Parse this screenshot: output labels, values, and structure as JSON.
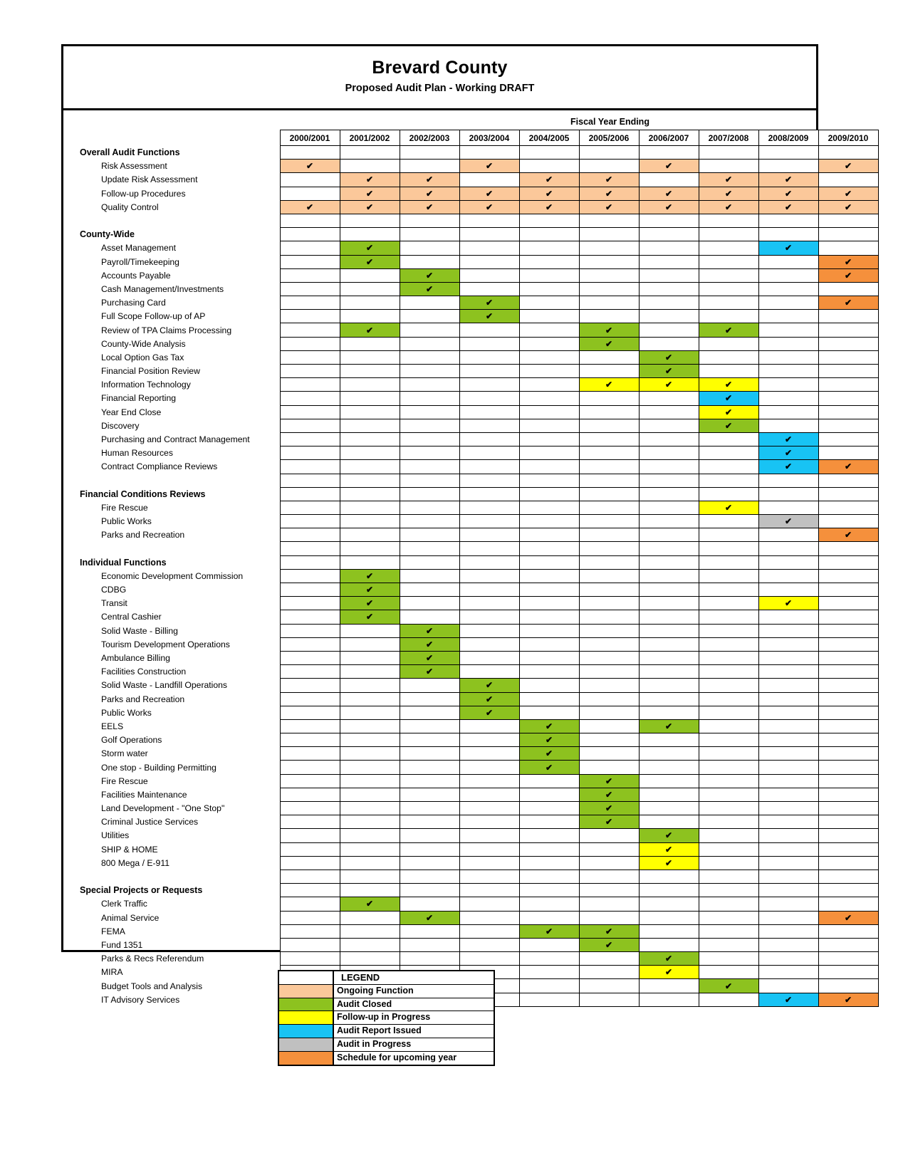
{
  "header": {
    "title": "Brevard County",
    "subtitle": "Proposed Audit Plan - Working DRAFT"
  },
  "matrix": {
    "fiscal_year_label": "Fiscal Year Ending",
    "years": [
      "2000/2001",
      "2001/2002",
      "2002/2003",
      "2003/2004",
      "2004/2005",
      "2005/2006",
      "2006/2007",
      "2007/2008",
      "2008/2009",
      "2009/2010"
    ],
    "check_glyph": "✔",
    "status_colors": {
      "ongoing": "#fbc89a",
      "closed": "#8dc21f",
      "followup": "#ffff00",
      "issued": "#18c3f4",
      "inprogress": "#c0c0c0",
      "upcoming": "#f5903c"
    },
    "rows": [
      {
        "type": "section",
        "label": "Overall Audit Functions",
        "cells": [
          "",
          "",
          "",
          "",
          "",
          "",
          "",
          "",
          "",
          ""
        ]
      },
      {
        "type": "item",
        "label": "Risk Assessment",
        "cells": [
          "ongoing",
          "",
          "",
          "ongoing",
          "",
          "",
          "ongoing",
          "",
          "",
          "ongoing"
        ]
      },
      {
        "type": "item",
        "label": "Update Risk Assessment",
        "cells": [
          "",
          "ongoing",
          "ongoing",
          "",
          "ongoing",
          "ongoing",
          "",
          "ongoing",
          "ongoing",
          ""
        ]
      },
      {
        "type": "item",
        "label": "Follow-up Procedures",
        "cells": [
          "",
          "ongoing",
          "ongoing",
          "ongoing",
          "ongoing",
          "ongoing",
          "ongoing",
          "ongoing",
          "ongoing",
          "ongoing"
        ]
      },
      {
        "type": "item",
        "label": "Quality Control",
        "cells": [
          "ongoing",
          "ongoing",
          "ongoing",
          "ongoing",
          "ongoing",
          "ongoing",
          "ongoing",
          "ongoing",
          "ongoing",
          "ongoing"
        ]
      },
      {
        "type": "blank",
        "label": "",
        "cells": [
          "",
          "",
          "",
          "",
          "",
          "",
          "",
          "",
          "",
          ""
        ]
      },
      {
        "type": "section",
        "label": "County-Wide",
        "cells": [
          "",
          "",
          "",
          "",
          "",
          "",
          "",
          "",
          "",
          ""
        ]
      },
      {
        "type": "item",
        "label": "Asset Management",
        "cells": [
          "",
          "closed",
          "",
          "",
          "",
          "",
          "",
          "",
          "issued",
          ""
        ]
      },
      {
        "type": "item",
        "label": "Payroll/Timekeeping",
        "cells": [
          "",
          "closed",
          "",
          "",
          "",
          "",
          "",
          "",
          "",
          "upcoming"
        ]
      },
      {
        "type": "item",
        "label": "Accounts Payable",
        "cells": [
          "",
          "",
          "closed",
          "",
          "",
          "",
          "",
          "",
          "",
          "upcoming"
        ]
      },
      {
        "type": "item",
        "label": "Cash Management/Investments",
        "cells": [
          "",
          "",
          "closed",
          "",
          "",
          "",
          "",
          "",
          "",
          ""
        ]
      },
      {
        "type": "item",
        "label": "Purchasing Card",
        "cells": [
          "",
          "",
          "",
          "closed",
          "",
          "",
          "",
          "",
          "",
          "upcoming"
        ]
      },
      {
        "type": "item",
        "label": "Full Scope Follow-up of AP",
        "cells": [
          "",
          "",
          "",
          "closed",
          "",
          "",
          "",
          "",
          "",
          ""
        ]
      },
      {
        "type": "item",
        "label": "Review of TPA Claims Processing",
        "cells": [
          "",
          "closed",
          "",
          "",
          "",
          "closed",
          "",
          "closed",
          "",
          ""
        ]
      },
      {
        "type": "item",
        "label": "County-Wide Analysis",
        "cells": [
          "",
          "",
          "",
          "",
          "",
          "closed",
          "",
          "",
          "",
          ""
        ]
      },
      {
        "type": "item",
        "label": "Local Option Gas Tax",
        "cells": [
          "",
          "",
          "",
          "",
          "",
          "",
          "closed",
          "",
          "",
          ""
        ]
      },
      {
        "type": "item",
        "label": "Financial Position Review",
        "cells": [
          "",
          "",
          "",
          "",
          "",
          "",
          "closed",
          "",
          "",
          ""
        ]
      },
      {
        "type": "item",
        "label": "Information Technology",
        "cells": [
          "",
          "",
          "",
          "",
          "",
          "followup",
          "followup",
          "followup",
          "",
          ""
        ]
      },
      {
        "type": "item",
        "label": "Financial Reporting",
        "cells": [
          "",
          "",
          "",
          "",
          "",
          "",
          "",
          "issued",
          "",
          ""
        ]
      },
      {
        "type": "item",
        "label": "Year End Close",
        "cells": [
          "",
          "",
          "",
          "",
          "",
          "",
          "",
          "followup",
          "",
          ""
        ]
      },
      {
        "type": "item",
        "label": "Discovery",
        "cells": [
          "",
          "",
          "",
          "",
          "",
          "",
          "",
          "closed",
          "",
          ""
        ]
      },
      {
        "type": "item",
        "label": "Purchasing and Contract Management",
        "cells": [
          "",
          "",
          "",
          "",
          "",
          "",
          "",
          "",
          "issued",
          ""
        ]
      },
      {
        "type": "item",
        "label": "Human Resources",
        "cells": [
          "",
          "",
          "",
          "",
          "",
          "",
          "",
          "",
          "issued",
          ""
        ]
      },
      {
        "type": "item",
        "label": "Contract Compliance Reviews",
        "cells": [
          "",
          "",
          "",
          "",
          "",
          "",
          "",
          "",
          "issued",
          "upcoming"
        ]
      },
      {
        "type": "blank",
        "label": "",
        "cells": [
          "",
          "",
          "",
          "",
          "",
          "",
          "",
          "",
          "",
          ""
        ]
      },
      {
        "type": "section",
        "label": "Financial Conditions Reviews",
        "cells": [
          "",
          "",
          "",
          "",
          "",
          "",
          "",
          "",
          "",
          ""
        ]
      },
      {
        "type": "item",
        "label": "Fire Rescue",
        "cells": [
          "",
          "",
          "",
          "",
          "",
          "",
          "",
          "followup",
          "",
          ""
        ]
      },
      {
        "type": "item",
        "label": "Public Works",
        "cells": [
          "",
          "",
          "",
          "",
          "",
          "",
          "",
          "",
          "inprogress",
          ""
        ]
      },
      {
        "type": "item",
        "label": "Parks and Recreation",
        "cells": [
          "",
          "",
          "",
          "",
          "",
          "",
          "",
          "",
          "",
          "upcoming"
        ]
      },
      {
        "type": "blank",
        "label": "",
        "cells": [
          "",
          "",
          "",
          "",
          "",
          "",
          "",
          "",
          "",
          ""
        ]
      },
      {
        "type": "section",
        "label": "Individual Functions",
        "cells": [
          "",
          "",
          "",
          "",
          "",
          "",
          "",
          "",
          "",
          ""
        ]
      },
      {
        "type": "item",
        "label": "Economic Development Commission",
        "cells": [
          "",
          "closed",
          "",
          "",
          "",
          "",
          "",
          "",
          "",
          ""
        ]
      },
      {
        "type": "item",
        "label": "CDBG",
        "cells": [
          "",
          "closed",
          "",
          "",
          "",
          "",
          "",
          "",
          "",
          ""
        ]
      },
      {
        "type": "item",
        "label": "Transit",
        "cells": [
          "",
          "closed",
          "",
          "",
          "",
          "",
          "",
          "",
          "followup",
          ""
        ]
      },
      {
        "type": "item",
        "label": "Central Cashier",
        "cells": [
          "",
          "closed",
          "",
          "",
          "",
          "",
          "",
          "",
          "",
          ""
        ]
      },
      {
        "type": "item",
        "label": "Solid Waste - Billing",
        "cells": [
          "",
          "",
          "closed",
          "",
          "",
          "",
          "",
          "",
          "",
          ""
        ]
      },
      {
        "type": "item",
        "label": "Tourism Development Operations",
        "cells": [
          "",
          "",
          "closed",
          "",
          "",
          "",
          "",
          "",
          "",
          ""
        ]
      },
      {
        "type": "item",
        "label": "Ambulance Billing",
        "cells": [
          "",
          "",
          "closed",
          "",
          "",
          "",
          "",
          "",
          "",
          ""
        ]
      },
      {
        "type": "item",
        "label": "Facilities Construction",
        "cells": [
          "",
          "",
          "closed",
          "",
          "",
          "",
          "",
          "",
          "",
          ""
        ]
      },
      {
        "type": "item",
        "label": "Solid Waste - Landfill Operations",
        "cells": [
          "",
          "",
          "",
          "closed",
          "",
          "",
          "",
          "",
          "",
          ""
        ]
      },
      {
        "type": "item",
        "label": "Parks and Recreation",
        "cells": [
          "",
          "",
          "",
          "closed",
          "",
          "",
          "",
          "",
          "",
          ""
        ]
      },
      {
        "type": "item",
        "label": "Public Works",
        "cells": [
          "",
          "",
          "",
          "closed",
          "",
          "",
          "",
          "",
          "",
          ""
        ]
      },
      {
        "type": "item",
        "label": "EELS",
        "cells": [
          "",
          "",
          "",
          "",
          "closed",
          "",
          "closed",
          "",
          "",
          ""
        ]
      },
      {
        "type": "item",
        "label": "Golf Operations",
        "cells": [
          "",
          "",
          "",
          "",
          "closed",
          "",
          "",
          "",
          "",
          ""
        ]
      },
      {
        "type": "item",
        "label": "Storm water",
        "cells": [
          "",
          "",
          "",
          "",
          "closed",
          "",
          "",
          "",
          "",
          ""
        ]
      },
      {
        "type": "item",
        "label": "One stop - Building Permitting",
        "cells": [
          "",
          "",
          "",
          "",
          "closed",
          "",
          "",
          "",
          "",
          ""
        ]
      },
      {
        "type": "item",
        "label": "Fire Rescue",
        "cells": [
          "",
          "",
          "",
          "",
          "",
          "closed",
          "",
          "",
          "",
          ""
        ]
      },
      {
        "type": "item",
        "label": "Facilities Maintenance",
        "cells": [
          "",
          "",
          "",
          "",
          "",
          "closed",
          "",
          "",
          "",
          ""
        ]
      },
      {
        "type": "item",
        "label": "Land Development - \"One Stop\"",
        "cells": [
          "",
          "",
          "",
          "",
          "",
          "closed",
          "",
          "",
          "",
          ""
        ]
      },
      {
        "type": "item",
        "label": "Criminal Justice Services",
        "cells": [
          "",
          "",
          "",
          "",
          "",
          "closed",
          "",
          "",
          "",
          ""
        ]
      },
      {
        "type": "item",
        "label": "Utilities",
        "cells": [
          "",
          "",
          "",
          "",
          "",
          "",
          "closed",
          "",
          "",
          ""
        ]
      },
      {
        "type": "item",
        "label": "SHIP & HOME",
        "cells": [
          "",
          "",
          "",
          "",
          "",
          "",
          "followup",
          "",
          "",
          ""
        ]
      },
      {
        "type": "item",
        "label": "800 Mega / E-911",
        "cells": [
          "",
          "",
          "",
          "",
          "",
          "",
          "followup",
          "",
          "",
          ""
        ]
      },
      {
        "type": "blank",
        "label": "",
        "cells": [
          "",
          "",
          "",
          "",
          "",
          "",
          "",
          "",
          "",
          ""
        ]
      },
      {
        "type": "section",
        "label": "Special Projects or Requests",
        "cells": [
          "",
          "",
          "",
          "",
          "",
          "",
          "",
          "",
          "",
          ""
        ]
      },
      {
        "type": "item",
        "label": "Clerk Traffic",
        "cells": [
          "",
          "closed",
          "",
          "",
          "",
          "",
          "",
          "",
          "",
          ""
        ]
      },
      {
        "type": "item",
        "label": "Animal Service",
        "cells": [
          "",
          "",
          "closed",
          "",
          "",
          "",
          "",
          "",
          "",
          "upcoming"
        ]
      },
      {
        "type": "item",
        "label": "FEMA",
        "cells": [
          "",
          "",
          "",
          "",
          "closed",
          "closed",
          "",
          "",
          "",
          ""
        ]
      },
      {
        "type": "item",
        "label": "Fund 1351",
        "cells": [
          "",
          "",
          "",
          "",
          "",
          "closed",
          "",
          "",
          "",
          ""
        ]
      },
      {
        "type": "item",
        "label": "Parks & Recs Referendum",
        "cells": [
          "",
          "",
          "",
          "",
          "",
          "",
          "closed",
          "",
          "",
          ""
        ]
      },
      {
        "type": "item",
        "label": "MIRA",
        "cells": [
          "",
          "",
          "",
          "",
          "",
          "",
          "followup",
          "",
          "",
          ""
        ]
      },
      {
        "type": "item",
        "label": "Budget Tools and Analysis",
        "cells": [
          "",
          "",
          "",
          "",
          "",
          "",
          "",
          "closed",
          "",
          ""
        ]
      },
      {
        "type": "item",
        "label": "IT Advisory Services",
        "cells": [
          "",
          "",
          "",
          "",
          "",
          "",
          "",
          "",
          "issued",
          "upcoming"
        ]
      }
    ]
  },
  "legend": {
    "title": "LEGEND",
    "entries": [
      {
        "label": "Ongoing Function",
        "status": "ongoing"
      },
      {
        "label": "Audit Closed",
        "status": "closed"
      },
      {
        "label": "Follow-up in Progress",
        "status": "followup"
      },
      {
        "label": "Audit Report Issued",
        "status": "issued"
      },
      {
        "label": "Audit in Progress",
        "status": "inprogress"
      },
      {
        "label": "Schedule for upcoming year",
        "status": "upcoming"
      }
    ]
  }
}
